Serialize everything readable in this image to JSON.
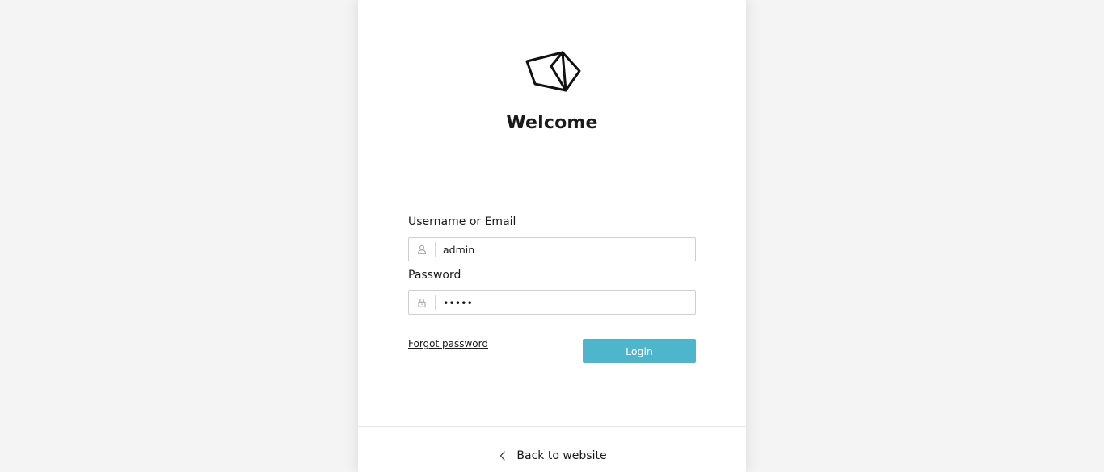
{
  "header": {
    "logo_icon": "paper-plane-logo-icon",
    "title": "Welcome"
  },
  "form": {
    "username": {
      "label": "Username or Email",
      "value": "admin",
      "icon": "user-icon"
    },
    "password": {
      "label": "Password",
      "value": "admin",
      "icon": "lock-icon"
    },
    "forgot_label": "Forgot password",
    "login_label": "Login"
  },
  "footer": {
    "back_label": "Back to website",
    "back_icon": "chevron-left-icon"
  },
  "colors": {
    "accent": "#4fb5cd",
    "background": "#f4f4f4",
    "card": "#ffffff"
  }
}
